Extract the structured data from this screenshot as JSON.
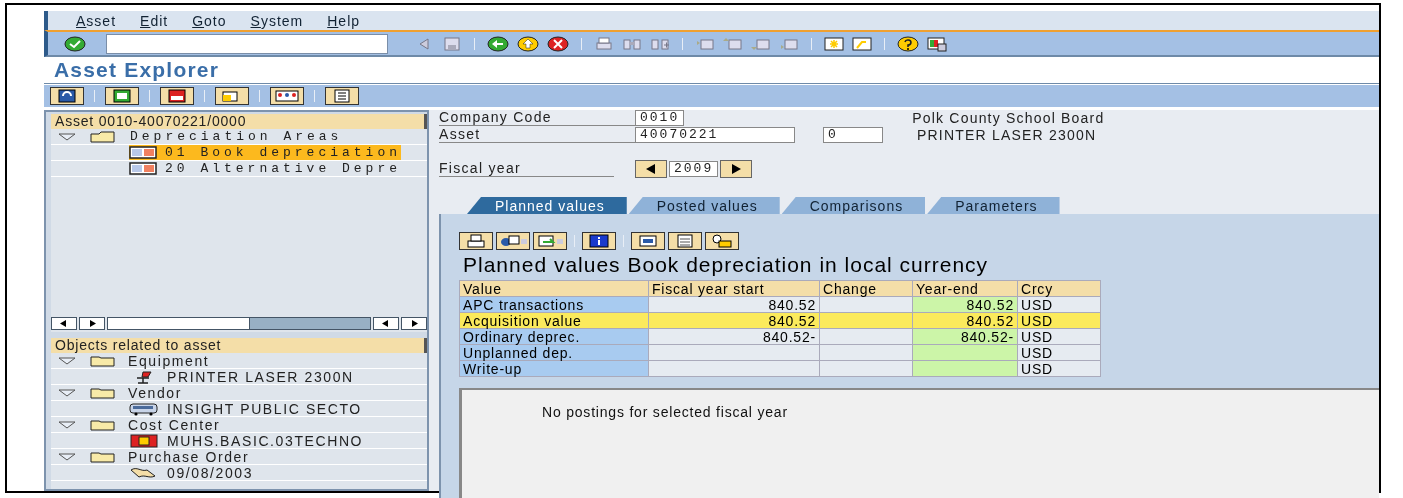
{
  "menu": [
    "Asset",
    "Edit",
    "Goto",
    "System",
    "Help"
  ],
  "title": "Asset Explorer",
  "asset_tree": {
    "header": "Asset 0010-40070221/0000",
    "items": [
      {
        "label": "Depreciation Areas",
        "expanded": true,
        "children": [
          {
            "label": "01 Book depreciation",
            "selected": true
          },
          {
            "label": "20 Alternative Depre",
            "selected": false
          }
        ]
      }
    ]
  },
  "related": {
    "header": "Objects related to asset",
    "items": [
      {
        "label": "Equipment",
        "expanded": true,
        "children": [
          {
            "label": "PRINTER LASER 2300N",
            "kind": "equipment"
          }
        ]
      },
      {
        "label": "Vendor",
        "expanded": true,
        "children": [
          {
            "label": "INSIGHT PUBLIC SECTO",
            "kind": "vendor"
          }
        ]
      },
      {
        "label": "Cost Center",
        "expanded": true,
        "children": [
          {
            "label": "MUHS.BASIC.03TECHNO",
            "kind": "cost_center"
          }
        ]
      },
      {
        "label": "Purchase Order",
        "expanded": true,
        "children": [
          {
            "label": "09/08/2003",
            "kind": "purchase_order"
          }
        ]
      }
    ]
  },
  "form": {
    "company_code": {
      "label": "Company Code",
      "value": "0010"
    },
    "asset": {
      "label": "Asset",
      "value": "40070221",
      "sub_number": "0"
    },
    "company_name": "Polk County School Board",
    "asset_description": "PRINTER LASER 2300N",
    "fiscal_year": {
      "label": "Fiscal year",
      "value": "2009"
    }
  },
  "tabs": [
    {
      "label": "Planned values",
      "selected": true
    },
    {
      "label": "Posted values",
      "selected": false
    },
    {
      "label": "Comparisons",
      "selected": false
    },
    {
      "label": "Parameters",
      "selected": false
    }
  ],
  "report_title": "Planned values Book depreciation in local currency",
  "table": {
    "columns": [
      "Value",
      "Fiscal year start",
      "Change",
      "Year-end",
      "Crcy"
    ],
    "rows": [
      {
        "cells": [
          "APC transactions",
          "840.52",
          "",
          "840.52",
          "USD"
        ],
        "selected": false
      },
      {
        "cells": [
          "Acquisition value",
          "840.52",
          "",
          "840.52",
          "USD"
        ],
        "selected": true
      },
      {
        "cells": [
          "Ordinary deprec.",
          "840.52-",
          "",
          "840.52-",
          "USD"
        ],
        "selected": false
      },
      {
        "cells": [
          "Unplanned dep.",
          "",
          "",
          "",
          "USD"
        ],
        "selected": false
      },
      {
        "cells": [
          "Write-up",
          "",
          "",
          "",
          "USD"
        ],
        "selected": false
      }
    ]
  },
  "message": "No postings for selected fiscal year"
}
